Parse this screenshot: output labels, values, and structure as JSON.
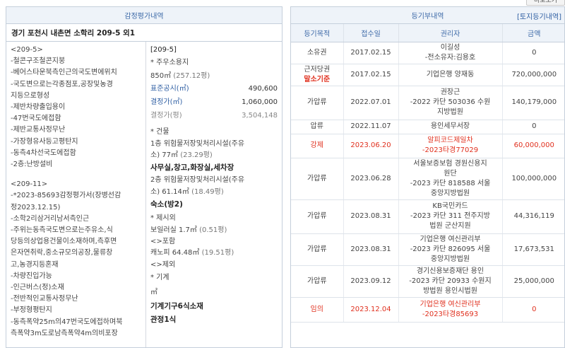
{
  "top_button": "바로보기",
  "appraisal": {
    "header": "감정평가내역",
    "address": "경기 포천시 내촌면 소학리 209-5 외1",
    "left_lines_a": [
      "<209-5>",
      "-철콘구조철콘지붕",
      "-베어스타운북측인근의국도변에위치",
      "-국도변으로는각종점포,공장및농경",
      "지등으로형성",
      "-제반차량출입용이",
      "-47번국도에접함",
      "-제반교통사정무난",
      "-가장형유사등고평탄지",
      "-동측4차선국도에접함",
      "-2층:난방설비"
    ],
    "left_lines_b": [
      "<209-11>",
      "-*2023-85693감정평가서(장병선감",
      "정2023.12.15)",
      "-소학2리삼거리남서측인근",
      "-주위는동측국도변으로는주유소,식",
      "당등의상업용건물이소재하며,측후면",
      "은자연취락,중소규모의공장,물류창",
      "고,농경지등혼재",
      "-차량진입가능",
      "-인근버스(정)소재",
      "-전반적인교통사정무난",
      "-부정형평탄지",
      "-동측폭약25m의47번국도에접하며북",
      "측폭약3m도로남측폭약4m의비포장"
    ],
    "right": {
      "parcel": "[209-5]",
      "land_title": "* 주우소용지",
      "land_area": "850㎡",
      "land_area_py": "(257.12평)",
      "official_label": "표준공시(㎡)",
      "official_value": "490,600",
      "decided_label": "결정가(㎡)",
      "decided_value": "1,060,000",
      "decided_py_label": "결정가(평)",
      "decided_py_value": "3,504,148",
      "building_title": "* 건물",
      "bld1_line1": "1층 위험물저장및처리시설(주유",
      "bld1_line2": "소) 77㎡",
      "bld1_py": "(23.29평)",
      "bld1_bold": "사무실,창고,화장실,세차장",
      "bld2_line1": "2층 위험물저장및처리시설(주유",
      "bld2_line2": "소) 61.14㎡",
      "bld2_py": "(18.49평)",
      "bld2_bold": "숙소(방2)",
      "excl_title": "* 제시외",
      "excl_line": "보일러실 1.7㎡",
      "excl_py": "(0.51평)",
      "incl_title": "<>포함",
      "incl_line": "캐노피 64.48㎡",
      "incl_py": "(19.51평)",
      "except_title": "<>제외",
      "machine_title": "* 기계",
      "machine_unit": "㎡",
      "machine_bold": "기계기구6식소재",
      "jeong_bold": "관정1식"
    }
  },
  "registry": {
    "header": "등기부내역",
    "link": "[토지등기내역]",
    "columns": [
      "등기목적",
      "접수일",
      "권리자",
      "금액"
    ],
    "rows": [
      {
        "purpose": "소유권",
        "date": "2017.02.15",
        "holder": "이길성\n-전소유자:김용호",
        "amount": "0",
        "red": false
      },
      {
        "purpose": "근저당권",
        "tag": "말소기준",
        "date": "2017.02.15",
        "holder": "기업은행 양재동",
        "amount": "720,000,000",
        "red": false
      },
      {
        "purpose": "가압류",
        "date": "2022.07.01",
        "holder": "권장근\n-2022 카단 503036 수원\n지방법원",
        "amount": "140,179,000",
        "red": false
      },
      {
        "purpose": "압류",
        "date": "2022.11.07",
        "holder": "용인세무서장",
        "amount": "0",
        "red": false
      },
      {
        "purpose": "강제",
        "date": "2023.06.20",
        "holder": "알피코드제일차\n-2023타경77029",
        "amount": "60,000,000",
        "red": true
      },
      {
        "purpose": "가압류",
        "date": "2023.06.28",
        "holder": "서울보증보험 경원신용지\n원단\n-2023 카단 818588 서울\n중앙지방법원",
        "amount": "100,000,000",
        "red": false
      },
      {
        "purpose": "가압류",
        "date": "2023.08.31",
        "holder": "KB국민카드\n-2023 카단 311 전주지방\n법원 군산지원",
        "amount": "44,316,119",
        "red": false
      },
      {
        "purpose": "가압류",
        "date": "2023.08.31",
        "holder": "기업은행 여신관리부\n-2023 카단 826095 서울\n중앙지방법원",
        "amount": "17,673,531",
        "red": false
      },
      {
        "purpose": "가압류",
        "date": "2023.09.12",
        "holder": "경기신용보증재단 용인\n-2023 카단 20933 수원지\n방법원 용인시법원",
        "amount": "25,000,000",
        "red": false
      },
      {
        "purpose": "임의",
        "date": "2023.12.04",
        "holder": "기업은행 여신관리부\n-2023타경85693",
        "amount": "0",
        "red": true
      }
    ]
  }
}
